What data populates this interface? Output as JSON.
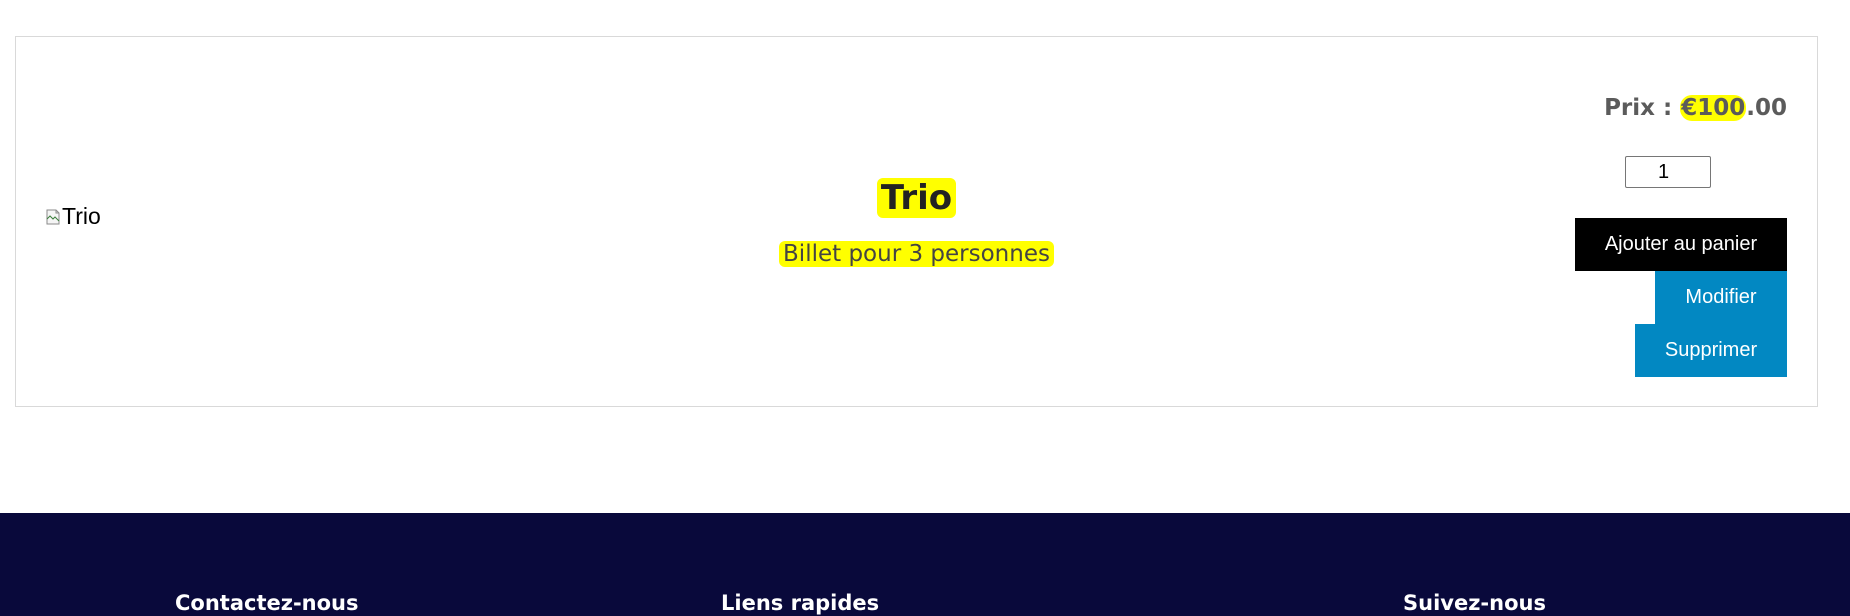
{
  "product": {
    "image_alt": "Trio",
    "title": "Trio",
    "description": "Billet pour 3 personnes",
    "price_label": "Prix : ",
    "price_currency": "€",
    "price_whole": "100",
    "price_decimal": ".00",
    "quantity": "1"
  },
  "actions": {
    "add_to_cart": "Ajouter au panier",
    "edit": "Modifier",
    "delete": "Supprimer"
  },
  "footer": {
    "contact_heading": "Contactez-nous",
    "links_heading": "Liens rapides",
    "follow_heading": "Suivez-nous"
  },
  "colors": {
    "highlight": "#ffff00",
    "cart_button": "#000000",
    "secondary_button": "#0288c2",
    "footer_background": "#09093b"
  }
}
